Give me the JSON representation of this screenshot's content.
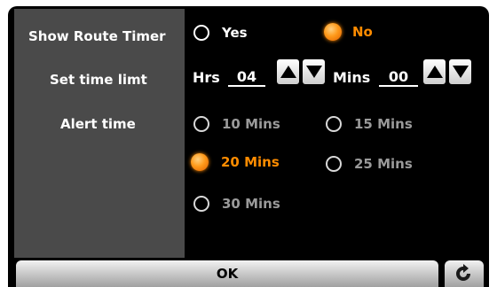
{
  "labels": {
    "show_route_timer": "Show Route Timer",
    "set_time_limit": "Set time limt",
    "alert_time": "Alert time"
  },
  "route_timer": {
    "yes": "Yes",
    "no": "No",
    "selected": "No"
  },
  "time_limit": {
    "hrs_label": "Hrs",
    "hrs_value": "04",
    "mins_label": "Mins",
    "mins_value": "00"
  },
  "alert_options": {
    "opt_10": "10 Mins",
    "opt_15": "15 Mins",
    "opt_20": "20 Mins",
    "opt_25": "25 Mins",
    "opt_30": "30 Mins",
    "selected": "20 Mins"
  },
  "footer": {
    "ok_label": "OK",
    "back_icon": "back-arrow-icon"
  },
  "colors": {
    "accent": "#ff8c00",
    "panel": "#4a4a4a",
    "background": "#000000"
  }
}
